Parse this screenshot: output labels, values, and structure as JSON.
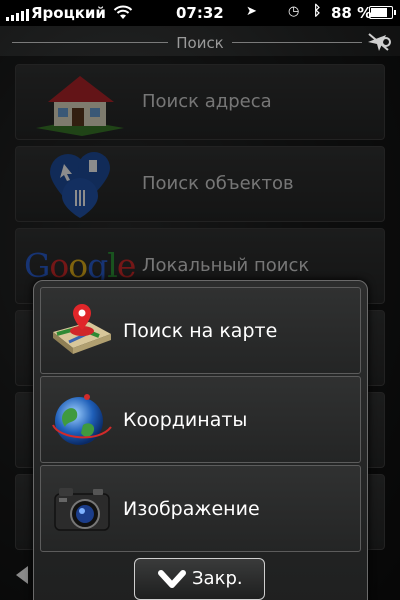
{
  "status_bar": {
    "carrier": "Яроцкий",
    "time": "07:32",
    "battery_percent": "88 %",
    "battery_level": 0.88,
    "icons": [
      "signal-icon",
      "wifi-icon",
      "location-arrow-icon",
      "alarm-icon",
      "bluetooth-icon",
      "battery-icon"
    ]
  },
  "header": {
    "title": "Поиск",
    "right_icon": "gps-off-icon"
  },
  "search_menu": {
    "items": [
      {
        "label": "Поиск адреса",
        "icon": "house-icon"
      },
      {
        "label": "Поиск объектов",
        "icon": "poi-pins-icon"
      },
      {
        "label": "Локальный поиск",
        "icon": "google-logo-icon",
        "logo_text": "Google"
      }
    ]
  },
  "popup_menu": {
    "items": [
      {
        "label": "Поиск на карте",
        "icon": "map-pin-icon"
      },
      {
        "label": "Координаты",
        "icon": "globe-icon"
      },
      {
        "label": "Изображение",
        "icon": "camera-icon"
      }
    ],
    "close_label": "Закр."
  },
  "colors": {
    "background": "#1c1d1d",
    "item_border": "#5c5c5c",
    "text": "#ffffff",
    "dim_text": "#d8d8d8"
  }
}
